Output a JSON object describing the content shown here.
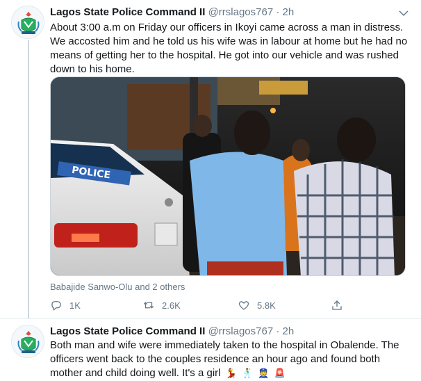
{
  "tweets": [
    {
      "author_name": "Lagos State Police Command II",
      "handle": "@rrslagos767",
      "separator": "·",
      "time": "2h",
      "text": "About 3:00 a.m on Friday our officers in Ikoyi came across a man in distress. We accosted him and he told us his wife was in labour at home but he had no means of getting her to the hospital. He got into our vehicle and was rushed down to his home.",
      "media_tag": "Babajide Sanwo-Olu and 2 others",
      "media_alt": "Police vehicle at night with officers and two men",
      "actions": {
        "reply_count": "1K",
        "retweet_count": "2.6K",
        "like_count": "5.8K"
      }
    },
    {
      "author_name": "Lagos State Police Command II",
      "handle": "@rrslagos767",
      "separator": "·",
      "time": "2h",
      "text": "Both man and wife were immediately taken to the hospital in Obalende. The officers went back to the couples residence an hour ago and found both mother and child doing well. It's a girl",
      "emojis": [
        "💃",
        "🕺",
        "👮",
        "🚨"
      ]
    }
  ],
  "icons": {
    "reply": "reply-icon",
    "retweet": "retweet-icon",
    "like": "heart-icon",
    "share": "share-icon",
    "caret": "chevron-down-icon"
  },
  "colors": {
    "text_primary": "#14171a",
    "text_secondary": "#657786",
    "divider": "#e6ecf0",
    "thread_line": "#ccd6dd"
  }
}
